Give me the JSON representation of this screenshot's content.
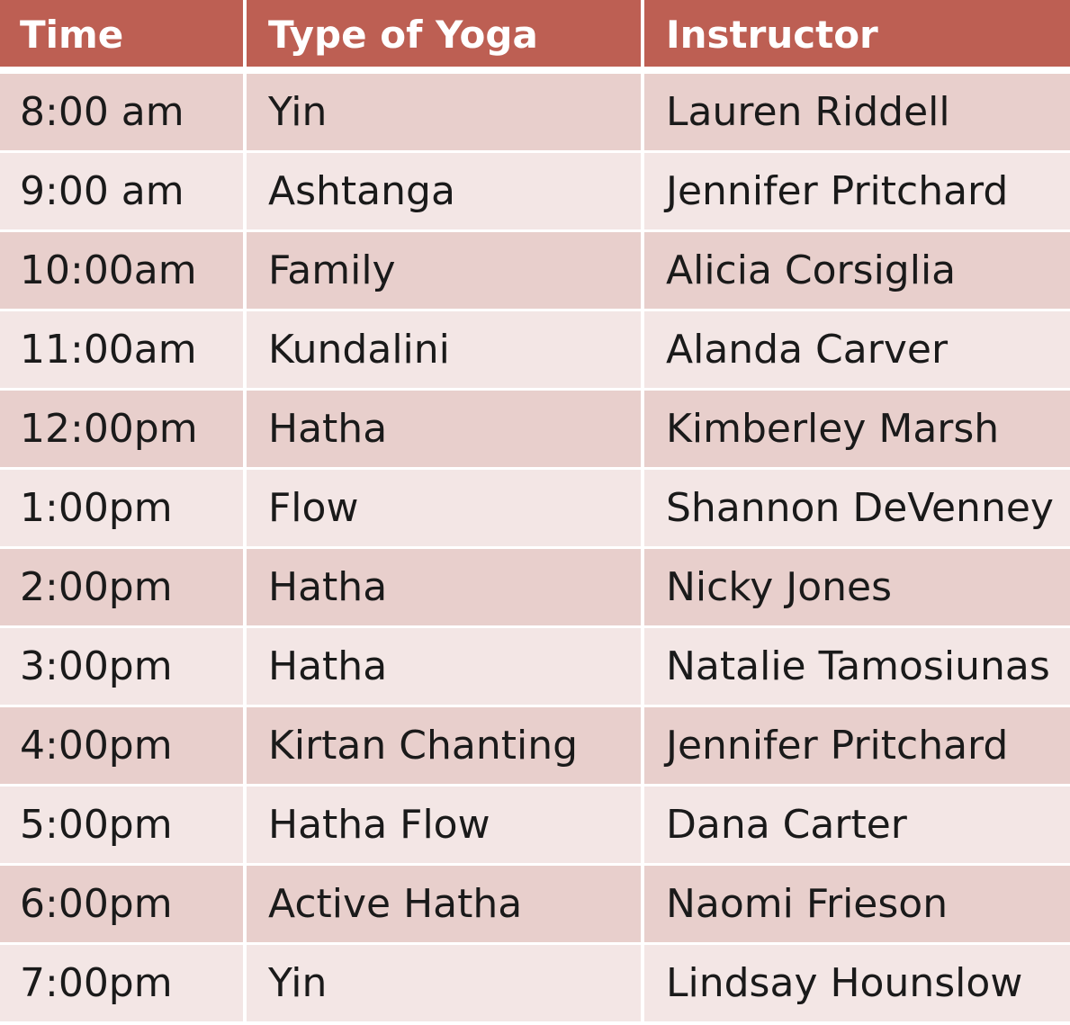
{
  "table": {
    "headers": [
      "Time",
      "Type of Yoga",
      "Instructor"
    ],
    "rows": [
      [
        "8:00 am",
        "Yin",
        "Lauren Riddell"
      ],
      [
        "9:00 am",
        "Ashtanga",
        "Jennifer Pritchard"
      ],
      [
        "10:00am",
        "Family",
        "Alicia Corsiglia"
      ],
      [
        "11:00am",
        "Kundalini",
        "Alanda Carver"
      ],
      [
        "12:00pm",
        "Hatha",
        "Kimberley Marsh"
      ],
      [
        "1:00pm",
        "Flow",
        "Shannon DeVenney"
      ],
      [
        "2:00pm",
        "Hatha",
        "Nicky Jones"
      ],
      [
        "3:00pm",
        "Hatha",
        "Natalie Tamosiunas"
      ],
      [
        "4:00pm",
        "Kirtan Chanting",
        "Jennifer Pritchard"
      ],
      [
        "5:00pm",
        "Hatha Flow",
        "Dana Carter"
      ],
      [
        "6:00pm",
        "Active Hatha",
        "Naomi Frieson"
      ],
      [
        "7:00pm",
        "Yin",
        "Lindsay Hounslow"
      ]
    ]
  },
  "colors": {
    "header_bg": "#bd5f53",
    "row_dark": "#e8cfcc",
    "row_light": "#f3e6e5",
    "header_text": "#ffffff",
    "body_text": "#1a1a1a"
  }
}
